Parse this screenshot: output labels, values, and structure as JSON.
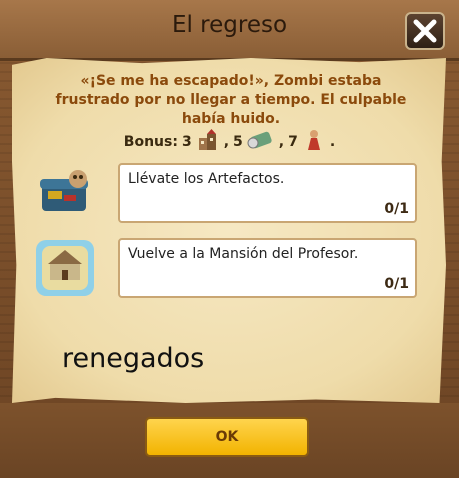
{
  "dialog": {
    "title": "El regreso",
    "description": "«¡Se me ha escapado!», Zombi estaba frustrado por no llegar a tiempo. El culpable había huido.",
    "bonus": {
      "label": "Bonus:",
      "items": [
        {
          "value": "3",
          "icon": "buildings-icon"
        },
        {
          "value": "5",
          "icon": "scroll-icon"
        },
        {
          "value": "7",
          "icon": "red-figure-icon"
        }
      ],
      "end": "."
    },
    "tasks": [
      {
        "text": "Llévate los Artefactos.",
        "progress": "0/1",
        "icon": "artifact-chest-icon"
      },
      {
        "text": "Vuelve a la Mansión del Profesor.",
        "progress": "0/1",
        "icon": "mansion-map-icon"
      }
    ],
    "overlay_text": "renegados",
    "ok_label": "OK"
  },
  "colors": {
    "frame": "#7a4f2a",
    "parchment": "#efdcaa",
    "description_text": "#8b4a0c",
    "ok_button": "#f2b300"
  }
}
